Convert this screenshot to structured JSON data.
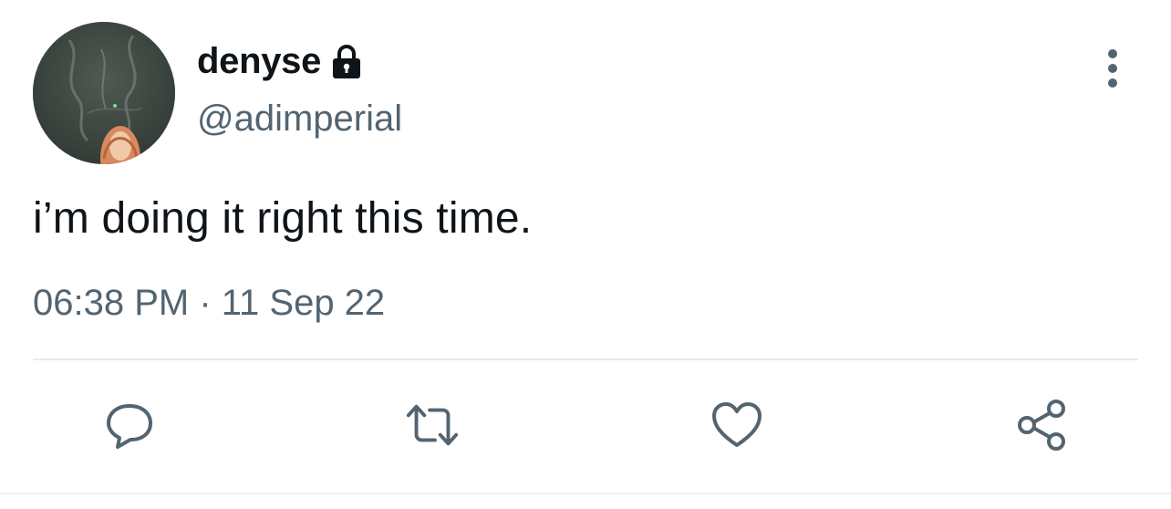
{
  "user": {
    "display_name": "denyse",
    "handle": "@adimperial",
    "protected": true
  },
  "tweet": {
    "text": "i’m doing it right this time.",
    "timestamp": "06:38 PM · 11 Sep 22"
  },
  "icons": {
    "protected": "lock-icon",
    "more": "more-vertical-icon",
    "reply": "reply-icon",
    "retweet": "retweet-icon",
    "like": "like-icon",
    "share": "share-icon"
  },
  "colors": {
    "text_primary": "#0f1419",
    "text_secondary": "#536471",
    "icon": "#536471",
    "divider": "#e6ecf0"
  }
}
